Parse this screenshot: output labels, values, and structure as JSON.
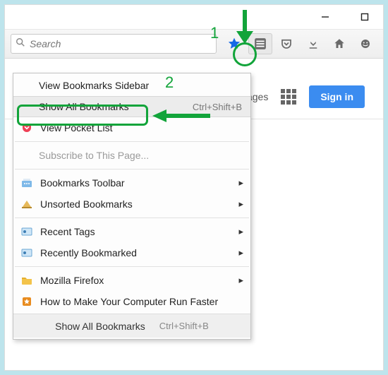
{
  "search": {
    "placeholder": "Search"
  },
  "page": {
    "images_link": "ages",
    "signin": "Sign in"
  },
  "menu": {
    "view_sidebar": "View Bookmarks Sidebar",
    "show_all": "Show All Bookmarks",
    "show_all_shortcut": "Ctrl+Shift+B",
    "pocket": "View Pocket List",
    "subscribe": "Subscribe to This Page...",
    "toolbar": "Bookmarks Toolbar",
    "unsorted": "Unsorted Bookmarks",
    "recent_tags": "Recent Tags",
    "recent_bm": "Recently Bookmarked",
    "mozilla": "Mozilla Firefox",
    "howto": "How to Make Your Computer Run Faster",
    "footer_label": "Show All Bookmarks",
    "footer_shortcut": "Ctrl+Shift+B"
  },
  "annotations": {
    "step1": "1",
    "step2": "2"
  }
}
